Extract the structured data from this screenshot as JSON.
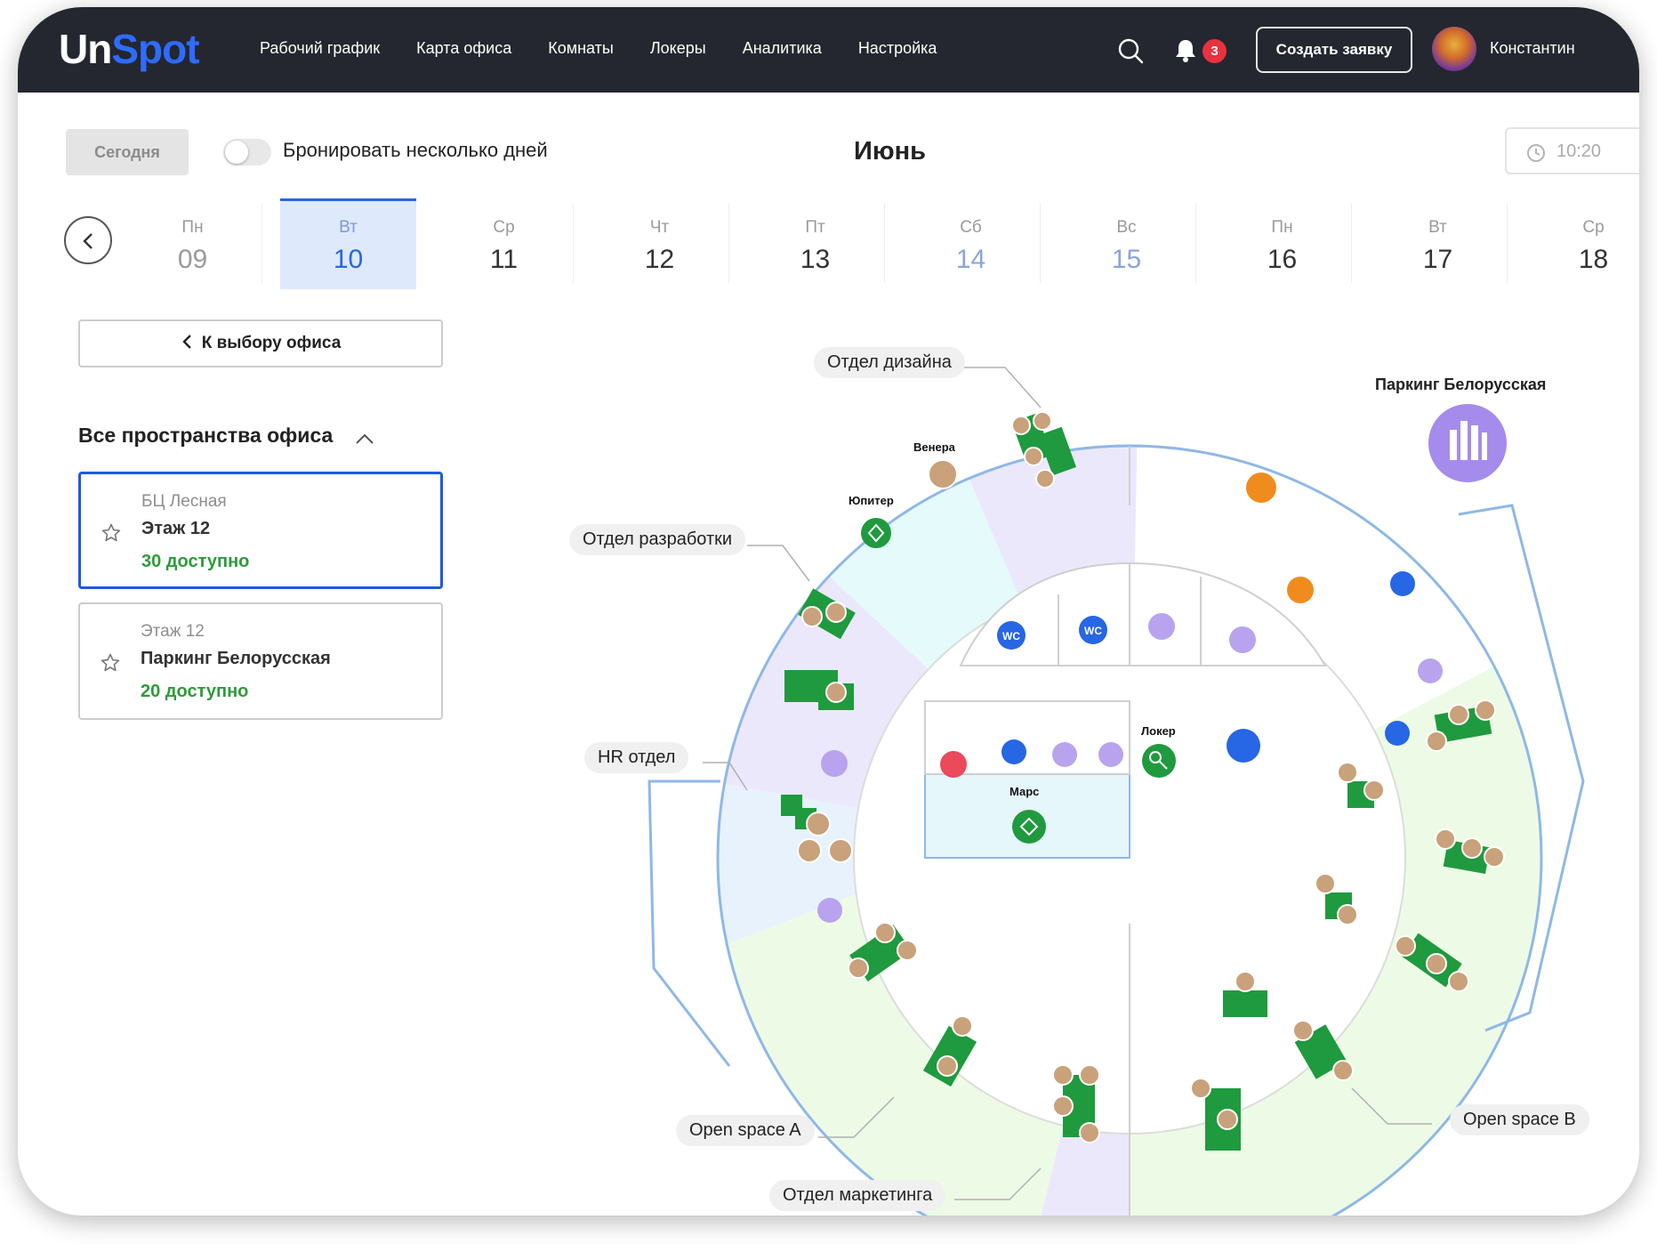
{
  "header": {
    "logo_un": "Un",
    "logo_spot": "Spot",
    "nav": [
      "Рабочий график",
      "Карта офиса",
      "Комнаты",
      "Локеры",
      "Аналитика",
      "Настройка"
    ],
    "notifications_count": "3",
    "create_button": "Создать заявку",
    "user_name": "Константин"
  },
  "toolbar": {
    "today_button": "Сегодня",
    "multi_day_label": "Бронировать несколько дней",
    "month": "Июнь",
    "time": "10:20"
  },
  "calendar": {
    "days": [
      {
        "name": "Пн",
        "date": "09"
      },
      {
        "name": "Вт",
        "date": "10"
      },
      {
        "name": "Ср",
        "date": "11"
      },
      {
        "name": "Чт",
        "date": "12"
      },
      {
        "name": "Пт",
        "date": "13"
      },
      {
        "name": "Сб",
        "date": "14"
      },
      {
        "name": "Вс",
        "date": "15"
      },
      {
        "name": "Пн",
        "date": "16"
      },
      {
        "name": "Вт",
        "date": "17"
      },
      {
        "name": "Ср",
        "date": "18"
      }
    ],
    "selected_index": 1
  },
  "sidebar": {
    "back_button": "К выбору офиса",
    "section_title": "Все пространства офиса",
    "offices": [
      {
        "building": "БЦ Лесная",
        "name": "Этаж 12",
        "available": "30 доступно"
      },
      {
        "building": "Этаж 12",
        "name": "Паркинг Белорусская",
        "available": "20 доступно"
      }
    ]
  },
  "map": {
    "zones": {
      "design": "Отдел дизайна",
      "dev": "Отдел разработки",
      "hr": "HR отдел",
      "open_a": "Open space A",
      "open_b": "Open space B",
      "marketing": "Отдел маркетинга"
    },
    "parking_title": "Паркинг Белорусская",
    "rooms": {
      "venera": "Венера",
      "jupiter": "Юпитер",
      "mars": "Марс",
      "locker": "Локер"
    },
    "wc_label": "WC",
    "colors": {
      "design_zone": "#ece8fb",
      "dev_zone": "#e5fafb",
      "open_zone": "#edfbe6",
      "desk": "#1f9a3e",
      "ring": "#8fb8e6",
      "accent": "#2766e4"
    }
  }
}
